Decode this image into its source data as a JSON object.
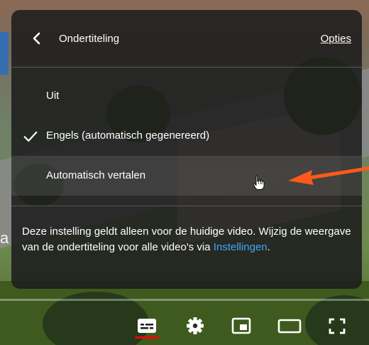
{
  "menu": {
    "header_title": "Ondertiteling",
    "options_link": "Opties",
    "items": [
      {
        "label": "Uit",
        "selected": false
      },
      {
        "label": "Engels (automatisch gegenereerd)",
        "selected": true
      },
      {
        "label": "Automatisch vertalen",
        "selected": false,
        "hovered": true
      }
    ],
    "info_text": "Deze instelling geldt alleen voor de huidige video. Wijzig de weergave van de ondertiteling voor alle video's via ",
    "info_link": "Instellingen",
    "info_suffix": "."
  },
  "video": {
    "edge_text": "a"
  },
  "controls": {
    "buttons": [
      "subtitles-icon",
      "settings-gear-icon",
      "miniplayer-icon",
      "theater-mode-icon",
      "fullscreen-icon"
    ],
    "active_button": "subtitles-icon"
  },
  "colors": {
    "panel_bg": "#1c1c1c",
    "link": "#3ea6ff",
    "active_underline": "#ff0000",
    "annotation_arrow": "#ff5a1a"
  }
}
